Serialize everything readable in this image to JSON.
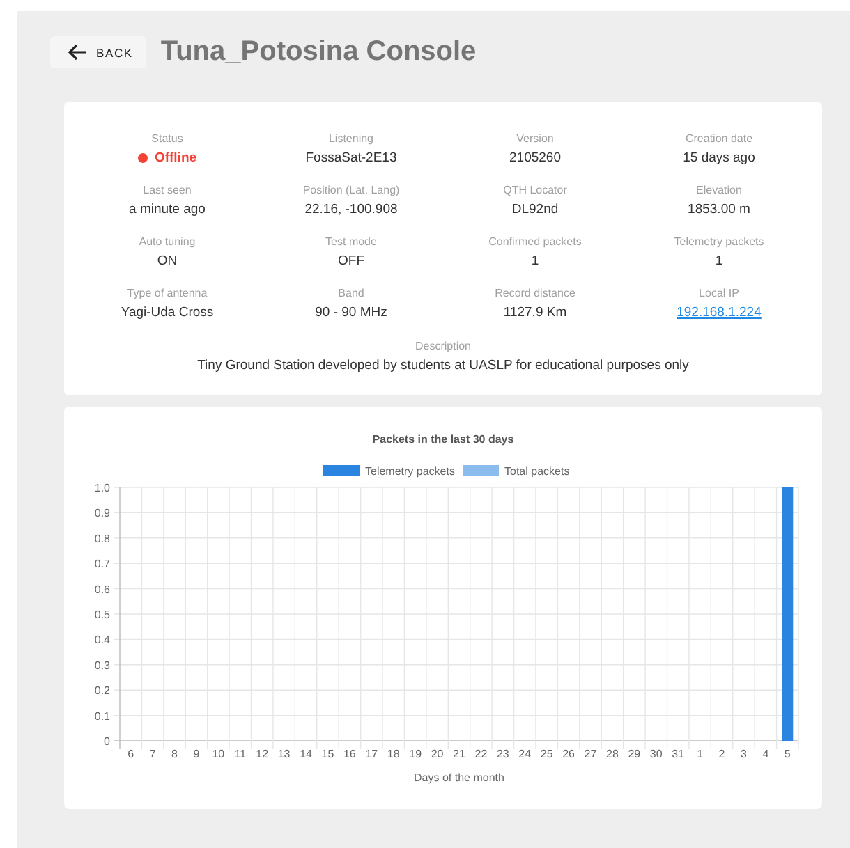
{
  "header": {
    "back_button": "BACK",
    "title": "Tuna_Potosina Console"
  },
  "info": [
    {
      "label": "Status",
      "value": "Offline",
      "kind": "status",
      "color": "#f44336"
    },
    {
      "label": "Listening",
      "value": "FossaSat-2E13",
      "kind": "text"
    },
    {
      "label": "Version",
      "value": "2105260",
      "kind": "text"
    },
    {
      "label": "Creation date",
      "value": "15 days ago",
      "kind": "text"
    },
    {
      "label": "Last seen",
      "value": "a minute ago",
      "kind": "text"
    },
    {
      "label": "Position (Lat, Lang)",
      "value": "22.16, -100.908",
      "kind": "text"
    },
    {
      "label": "QTH Locator",
      "value": "DL92nd",
      "kind": "text"
    },
    {
      "label": "Elevation",
      "value": "1853.00 m",
      "kind": "text"
    },
    {
      "label": "Auto tuning",
      "value": "ON",
      "kind": "text"
    },
    {
      "label": "Test mode",
      "value": "OFF",
      "kind": "text"
    },
    {
      "label": "Confirmed packets",
      "value": "1",
      "kind": "text"
    },
    {
      "label": "Telemetry packets",
      "value": "1",
      "kind": "text"
    },
    {
      "label": "Type of antenna",
      "value": "Yagi-Uda Cross",
      "kind": "text"
    },
    {
      "label": "Band",
      "value": "90 - 90 MHz",
      "kind": "text"
    },
    {
      "label": "Record distance",
      "value": "1127.9 Km",
      "kind": "text"
    },
    {
      "label": "Local IP",
      "value": "192.168.1.224",
      "kind": "link"
    }
  ],
  "description": {
    "label": "Description",
    "value": "Tiny Ground Station developed by students at UASLP for educational purposes only"
  },
  "chart": {
    "chart_data": {
      "type": "bar",
      "title": "Packets in the last 30 days",
      "xlabel": "Days of the month",
      "grid": true,
      "categories": [
        "6",
        "7",
        "8",
        "9",
        "10",
        "11",
        "12",
        "13",
        "14",
        "15",
        "16",
        "17",
        "18",
        "19",
        "20",
        "21",
        "22",
        "23",
        "24",
        "25",
        "26",
        "27",
        "28",
        "29",
        "30",
        "31",
        "1",
        "2",
        "3",
        "4",
        "5"
      ],
      "series": [
        {
          "name": "Telemetry packets",
          "color": "#2a84e0",
          "values": [
            0,
            0,
            0,
            0,
            0,
            0,
            0,
            0,
            0,
            0,
            0,
            0,
            0,
            0,
            0,
            0,
            0,
            0,
            0,
            0,
            0,
            0,
            0,
            0,
            0,
            0,
            0,
            0,
            0,
            0,
            1
          ]
        },
        {
          "name": "Total packets",
          "color": "#8abcee",
          "values": [
            0,
            0,
            0,
            0,
            0,
            0,
            0,
            0,
            0,
            0,
            0,
            0,
            0,
            0,
            0,
            0,
            0,
            0,
            0,
            0,
            0,
            0,
            0,
            0,
            0,
            0,
            0,
            0,
            0,
            0,
            0
          ]
        }
      ],
      "ylim": [
        0,
        1
      ],
      "yticks": [
        0,
        0.1,
        0.2,
        0.3,
        0.4,
        0.5,
        0.6,
        0.7,
        0.8,
        0.9,
        {
          "value": 1,
          "label": "1.0"
        }
      ]
    }
  }
}
